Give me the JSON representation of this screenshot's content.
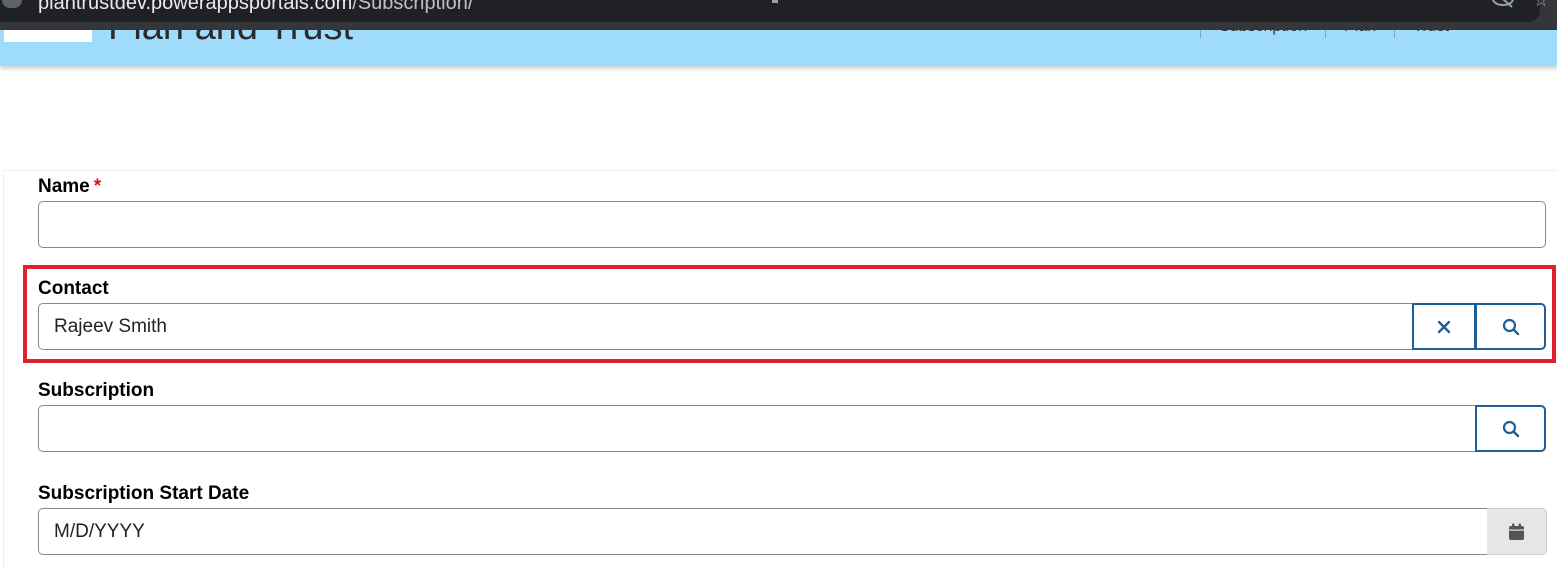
{
  "browser": {
    "url_host": "plantrustdev.powerappsportals.com",
    "url_path": "/Subscription/"
  },
  "site": {
    "title": "Plan and Trust",
    "nav_links": [
      "Subscription",
      "Plan",
      "Trust"
    ]
  },
  "form": {
    "name": {
      "label": "Name",
      "required_marker": "*",
      "value": ""
    },
    "contact": {
      "label": "Contact",
      "value": "Rajeev Smith",
      "clear_icon": "close-icon",
      "search_icon": "search-icon"
    },
    "subscription": {
      "label": "Subscription",
      "value": "",
      "search_icon": "search-icon"
    },
    "subscription_start_date": {
      "label": "Subscription Start Date",
      "placeholder": "M/D/YYYY",
      "calendar_icon": "calendar-icon"
    }
  },
  "colors": {
    "header_bg": "#9fdcfb",
    "highlight": "#e0202c",
    "button_border": "#1f5f95",
    "required": "#d1121f"
  }
}
